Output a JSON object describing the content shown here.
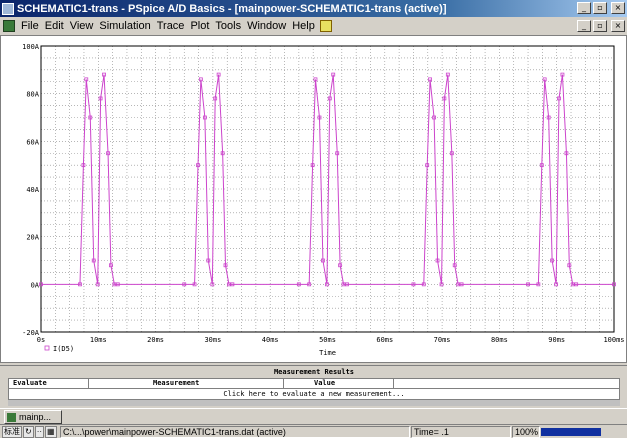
{
  "window": {
    "title": "SCHEMATIC1-trans - PSpice A/D Basics - [mainpower-SCHEMATIC1-trans (active)]"
  },
  "menu": [
    "File",
    "Edit",
    "View",
    "Simulation",
    "Trace",
    "Plot",
    "Tools",
    "Window",
    "Help"
  ],
  "window_buttons": {
    "minimize": "_",
    "restore": "▫",
    "close": "×"
  },
  "chart_data": {
    "type": "line",
    "xlabel": "Time",
    "ylabel": "",
    "x_ticks": [
      "0s",
      "10ms",
      "20ms",
      "30ms",
      "40ms",
      "50ms",
      "60ms",
      "70ms",
      "80ms",
      "90ms",
      "100ms"
    ],
    "y_ticks": [
      "100A",
      "80A",
      "60A",
      "40A",
      "20A",
      "0A",
      "-20A"
    ],
    "xlim": [
      0,
      100
    ],
    "xunit": "ms",
    "ylim": [
      -20,
      100
    ],
    "yunit": "A",
    "grid": true,
    "legend_placement": "bottom-left",
    "series": [
      {
        "name": "I(D5)",
        "color": "#cc44cc",
        "x": [
          0,
          6.8,
          7.4,
          7.9,
          8.6,
          9.2,
          9.9,
          10.4,
          11.0,
          11.7,
          12.2,
          12.8,
          13.4,
          25.0,
          26.8,
          27.4,
          27.9,
          28.6,
          29.2,
          29.9,
          30.4,
          31.0,
          31.7,
          32.2,
          32.8,
          33.4,
          45.0,
          46.8,
          47.4,
          47.9,
          48.6,
          49.2,
          49.9,
          50.4,
          51.0,
          51.7,
          52.2,
          52.8,
          53.4,
          65.0,
          66.8,
          67.4,
          67.9,
          68.6,
          69.2,
          69.9,
          70.4,
          71.0,
          71.7,
          72.2,
          72.8,
          73.4,
          85.0,
          86.8,
          87.4,
          87.9,
          88.6,
          89.2,
          89.9,
          90.4,
          91.0,
          91.7,
          92.2,
          92.8,
          93.4,
          100
        ],
        "y": [
          0,
          0,
          50,
          86,
          70,
          10,
          0,
          78,
          88,
          55,
          8,
          0,
          0,
          0,
          0,
          50,
          86,
          70,
          10,
          0,
          78,
          88,
          55,
          8,
          0,
          0,
          0,
          0,
          50,
          86,
          70,
          10,
          0,
          78,
          88,
          55,
          8,
          0,
          0,
          0,
          0,
          50,
          86,
          70,
          10,
          0,
          78,
          88,
          55,
          8,
          0,
          0,
          0,
          0,
          50,
          86,
          70,
          10,
          0,
          78,
          88,
          55,
          8,
          0,
          0,
          0
        ]
      }
    ]
  },
  "measurement": {
    "title": "Measurement Results",
    "columns": [
      "Evaluate",
      "Measurement",
      "Value"
    ],
    "click_row": "Click here to evaluate a new measurement..."
  },
  "tabs": [
    "mainp..."
  ],
  "statusbar": {
    "ime": [
      "标准",
      "↻",
      "··",
      "▦"
    ],
    "path": "C:\\...\\power\\mainpower-SCHEMATIC1-trans.dat (active)",
    "time": "Time= .1",
    "zoom": "100%"
  }
}
